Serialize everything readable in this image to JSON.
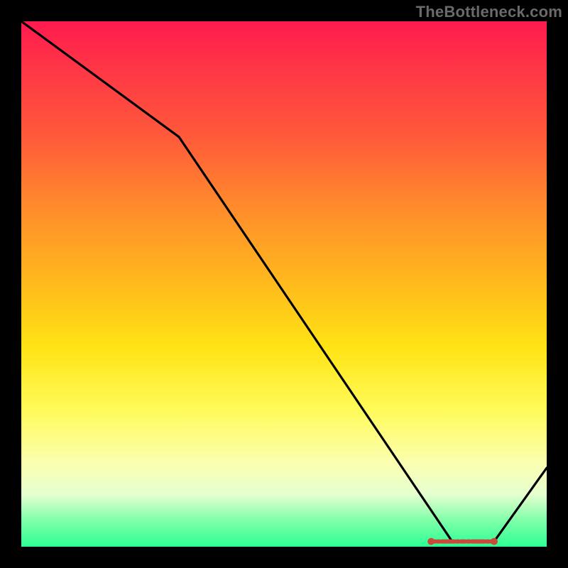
{
  "watermark": "TheBottleneck.com",
  "chart_data": {
    "type": "line",
    "title": "",
    "xlabel": "",
    "ylabel": "",
    "xlim": [
      0,
      100
    ],
    "ylim": [
      0,
      100
    ],
    "x": [
      0,
      30,
      82,
      90,
      100
    ],
    "values": [
      100,
      78,
      1,
      1,
      15
    ],
    "annotations": [],
    "gradient_bands": [
      {
        "color": "#ff1a4f",
        "stop": 0
      },
      {
        "color": "#ff3048",
        "stop": 7
      },
      {
        "color": "#ff5a3a",
        "stop": 22
      },
      {
        "color": "#ff8a2c",
        "stop": 35
      },
      {
        "color": "#ffb41e",
        "stop": 48
      },
      {
        "color": "#ffe314",
        "stop": 62
      },
      {
        "color": "#fffb5a",
        "stop": 74
      },
      {
        "color": "#fbffb0",
        "stop": 84
      },
      {
        "color": "#e6ffd0",
        "stop": 90
      },
      {
        "color": "#7fffa8",
        "stop": 95
      },
      {
        "color": "#2dff94",
        "stop": 100
      }
    ],
    "bottom_marker": {
      "x_start": 78,
      "x_end": 90,
      "y": 1,
      "shape": "dotted-band"
    }
  },
  "colors": {
    "frame": "#000000",
    "line": "#000000",
    "marker": "#c94a3b",
    "watermark": "#6a6a6a"
  }
}
